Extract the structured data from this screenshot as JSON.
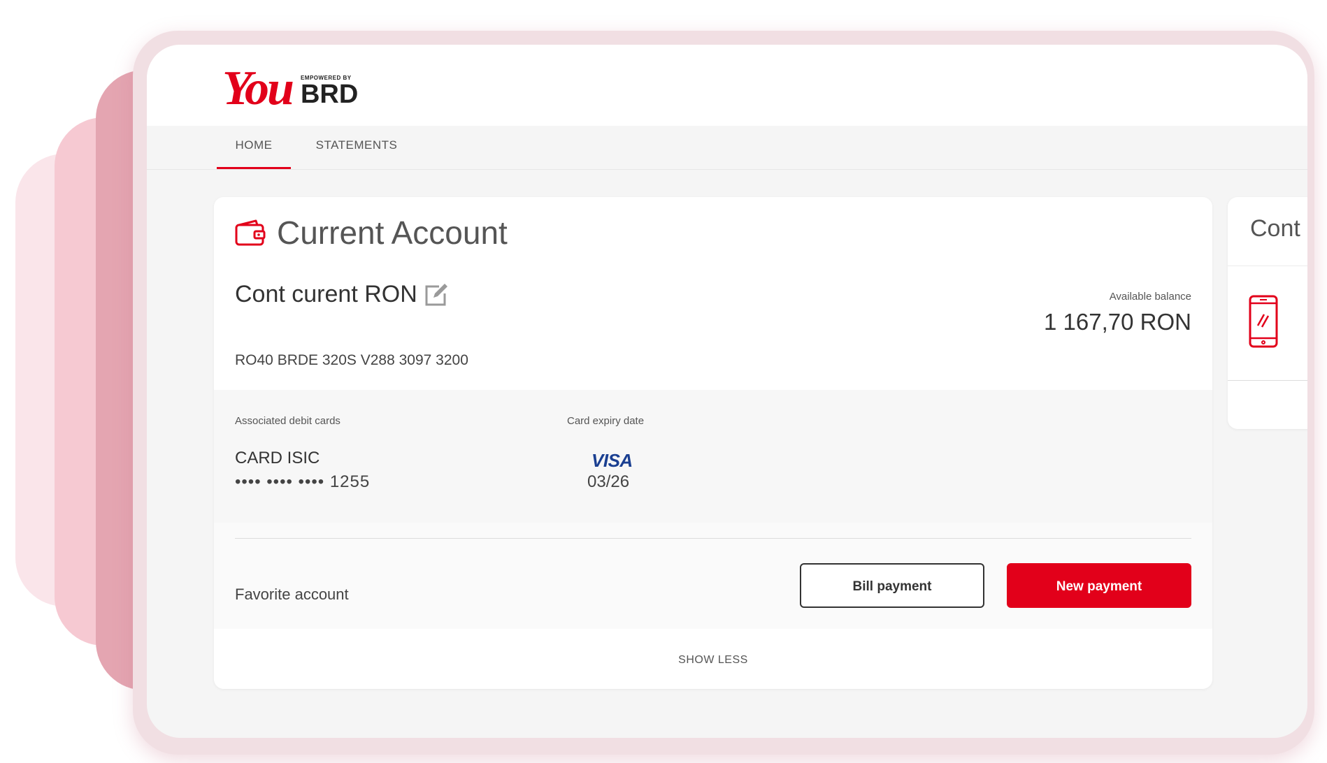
{
  "brand": {
    "logo_you": "You",
    "logo_empowered": "EMPOWERED BY",
    "logo_brd": "BRD",
    "accent_color": "#e2001a"
  },
  "nav": {
    "tabs": [
      {
        "label": "HOME",
        "active": true
      },
      {
        "label": "STATEMENTS",
        "active": false
      }
    ]
  },
  "account_card": {
    "title": "Current Account",
    "icon": "wallet-icon",
    "account_name": "Cont curent RON",
    "iban": "RO40 BRDE 320S V288 3097 3200",
    "balance_label": "Available balance",
    "balance_value": "1 167,70 RON",
    "debit_cards_label": "Associated debit cards",
    "expiry_label": "Card expiry date",
    "card_name": "CARD ISIC",
    "card_number": "•••• •••• •••• 1255",
    "card_brand": "VISA",
    "card_expiry": "03/26",
    "favorite_label": "Favorite account",
    "bill_payment_label": "Bill payment",
    "new_payment_label": "New payment",
    "show_less_label": "SHOW LESS"
  },
  "secondary_card": {
    "title": "Cont",
    "icon": "phone-icon"
  }
}
